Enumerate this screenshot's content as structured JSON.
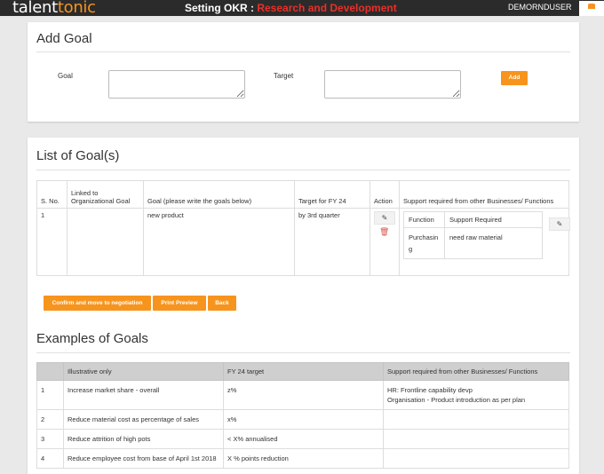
{
  "header": {
    "logo_part1": "talent",
    "logo_part2": "tonic",
    "title_prefix": "Setting OKR : ",
    "title_department": "Research and Development",
    "username": "DEMORNDUSER",
    "user_icon": "user-icon"
  },
  "add_goal": {
    "title": "Add Goal",
    "goal_label": "Goal",
    "goal_value": "",
    "target_label": "Target",
    "target_value": "",
    "add_button": "Add"
  },
  "goal_list": {
    "title": "List of Goal(s)",
    "columns": [
      "S. No.",
      "Linked to Organizational Goal",
      "Goal (please write the goals below)",
      "Target for FY 24",
      "Action",
      "Support required from other Businesses/ Functions"
    ],
    "rows": [
      {
        "sno": "1",
        "linked": "",
        "goal": "new product",
        "target": "by 3rd quarter",
        "support_columns": [
          "Function",
          "Support Required"
        ],
        "support_rows": [
          {
            "function": "Purchasing",
            "support": "need raw material"
          }
        ]
      }
    ],
    "buttons": {
      "confirm": "Confirm and move to negotiation",
      "print": "Print Preview",
      "back": "Back"
    }
  },
  "examples": {
    "title": "Examples of Goals",
    "columns": [
      "",
      "Illustrative only",
      "FY 24 target",
      "Support required from other Businesses/ Functions"
    ],
    "rows": [
      {
        "sno": "1",
        "goal": "Increase market share - overall",
        "target": "z%",
        "support_line1": "HR: Frontline capability devp",
        "support_line2": "Organisation - Product introduction as per plan"
      },
      {
        "sno": "2",
        "goal": "Reduce material cost as percentage of sales",
        "target": "x%",
        "support_line1": "",
        "support_line2": ""
      },
      {
        "sno": "3",
        "goal": "Reduce attrition of high pots",
        "target": "< X% annualised",
        "support_line1": "",
        "support_line2": ""
      },
      {
        "sno": "4",
        "goal": "Reduce employee cost from base of April 1st 2018",
        "target": "X % points reduction",
        "support_line1": "",
        "support_line2": ""
      }
    ]
  },
  "colors": {
    "accent": "#f7941d",
    "header_bg": "#2b2b2b",
    "department": "#e8302a",
    "delete": "#d9534f"
  }
}
